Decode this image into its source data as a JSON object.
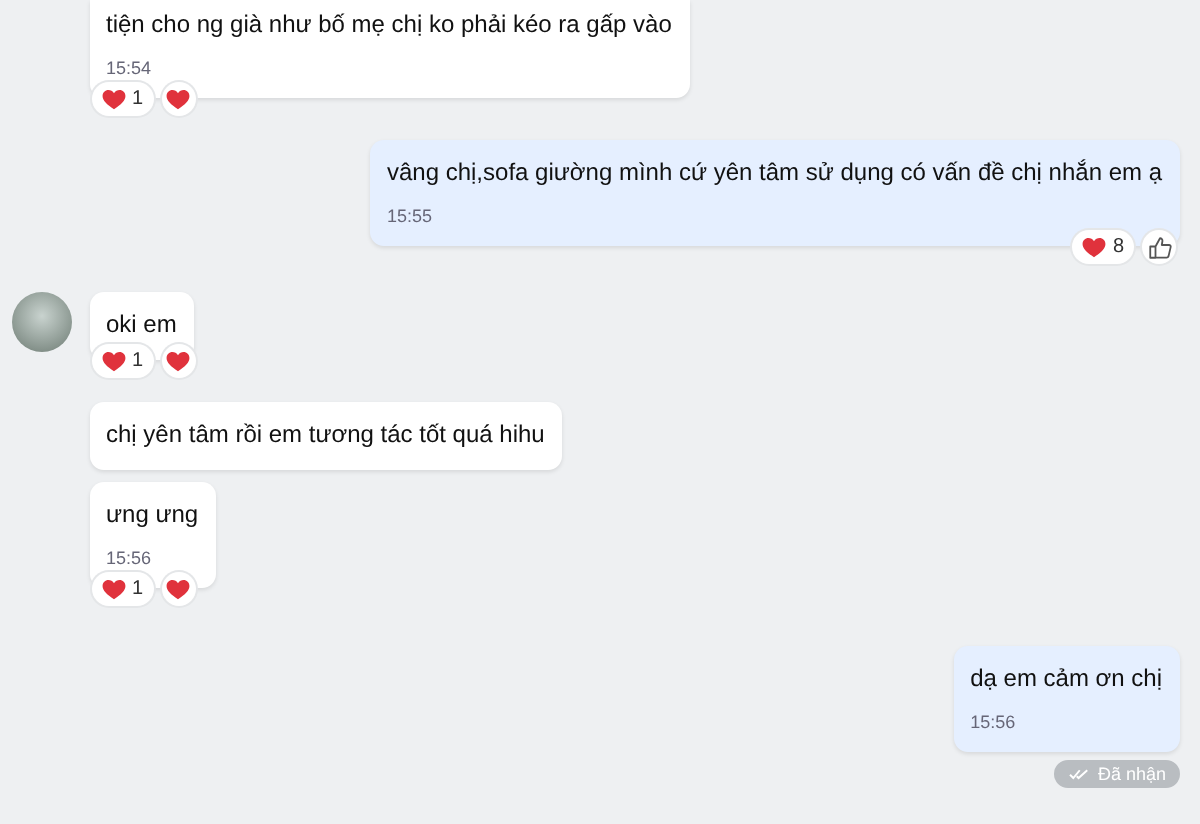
{
  "messages": [
    {
      "kind": "incoming",
      "avatar": false,
      "text": "tiện cho ng già như bố mẹ chị ko phải kéo ra gấp vào",
      "time": "15:54",
      "reaction": {
        "count": "1"
      },
      "react_button": {
        "kind": "heart"
      }
    },
    {
      "kind": "outgoing",
      "text": "vâng chị,sofa giường mình cứ yên tâm sử dụng có vấn đề chị nhắn em ạ",
      "time": "15:55",
      "reaction": {
        "count": "8"
      },
      "react_button": {
        "kind": "like"
      }
    },
    {
      "kind": "incoming",
      "avatar": true,
      "text": "oki em",
      "reaction": {
        "count": "1"
      },
      "react_button": {
        "kind": "heart"
      }
    },
    {
      "kind": "incoming",
      "avatar": false,
      "text": "chị yên tâm rồi em tương tác tốt quá hihu"
    },
    {
      "kind": "incoming",
      "avatar": false,
      "text": "ưng ưng",
      "time": "15:56",
      "reaction": {
        "count": "1"
      },
      "react_button": {
        "kind": "heart"
      }
    },
    {
      "kind": "outgoing",
      "text": "dạ em cảm ơn chị",
      "time": "15:56",
      "status": "Đã nhận"
    }
  ]
}
